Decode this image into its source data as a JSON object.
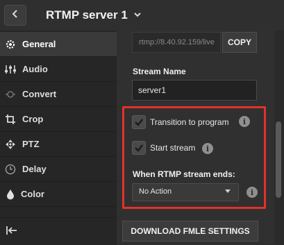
{
  "header": {
    "title": "RTMP server 1",
    "back_icon": "chevron-left-icon",
    "dropdown_icon": "chevron-down-icon"
  },
  "sidebar": {
    "items": [
      {
        "label": "General",
        "icon": "gear-icon",
        "active": true
      },
      {
        "label": "Audio",
        "icon": "mixer-sliders-icon",
        "active": false
      },
      {
        "label": "Convert",
        "icon": "convert-icon",
        "active": false
      },
      {
        "label": "Crop",
        "icon": "crop-icon",
        "active": false
      },
      {
        "label": "PTZ",
        "icon": "ptz-icon",
        "active": false
      },
      {
        "label": "Delay",
        "icon": "clock-icon",
        "active": false
      },
      {
        "label": "Color",
        "icon": "droplet-icon",
        "active": false
      }
    ],
    "collapse_icon": "collapse-left-icon"
  },
  "main": {
    "url_value": "rtmp://8.40.92.159/live",
    "copy_label": "COPY",
    "stream_name_label": "Stream Name",
    "stream_name_value": "server1",
    "transition_label": "Transition to program",
    "start_stream_label": "Start stream",
    "ends_label": "When RTMP stream ends:",
    "ends_select_value": "No Action",
    "download_label": "DOWNLOAD FMLE SETTINGS"
  },
  "colors": {
    "highlight": "#e4312b",
    "background": "#2b2b2b"
  }
}
